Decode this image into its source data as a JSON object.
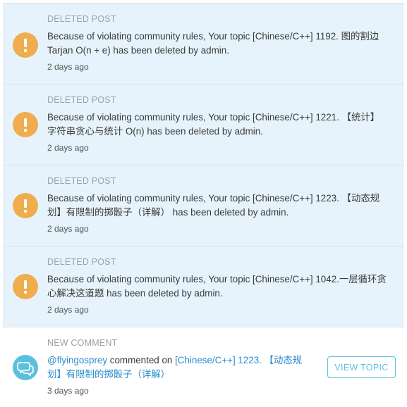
{
  "notifications": [
    {
      "type_label": "DELETED POST",
      "message": "Because of violating community rules, Your topic [Chinese/C++] 1192. 图的割边 Tarjan O(n + e) has been deleted by admin.",
      "time": "2 days ago",
      "icon": "exclamation-icon"
    },
    {
      "type_label": "DELETED POST",
      "message": "Because of violating community rules, Your topic [Chinese/C++] 1221. 【统计】字符串贪心与统计 O(n) has been deleted by admin.",
      "time": "2 days ago",
      "icon": "exclamation-icon"
    },
    {
      "type_label": "DELETED POST",
      "message": "Because of violating community rules, Your topic [Chinese/C++] 1223. 【动态规划】有限制的掷骰子（详解） has been deleted by admin.",
      "time": "2 days ago",
      "icon": "exclamation-icon"
    },
    {
      "type_label": "DELETED POST",
      "message": "Because of violating community rules, Your topic [Chinese/C++] 1042.一层循环贪心解决这道题 has been deleted by admin.",
      "time": "2 days ago",
      "icon": "exclamation-icon"
    }
  ],
  "comment": {
    "type_label": "NEW COMMENT",
    "user": "@flyingosprey",
    "action": " commented on ",
    "topic": "[Chinese/C++] 1223. 【动态规划】有限制的掷骰子（详解）",
    "time": "3 days ago",
    "button_label": "VIEW TOPIC",
    "icon": "chat-bubbles-icon"
  },
  "colors": {
    "deleted_bg": "#e6f3fc",
    "warning": "#f0ad4e",
    "info": "#5bc0de",
    "link": "#2a8ccf"
  }
}
